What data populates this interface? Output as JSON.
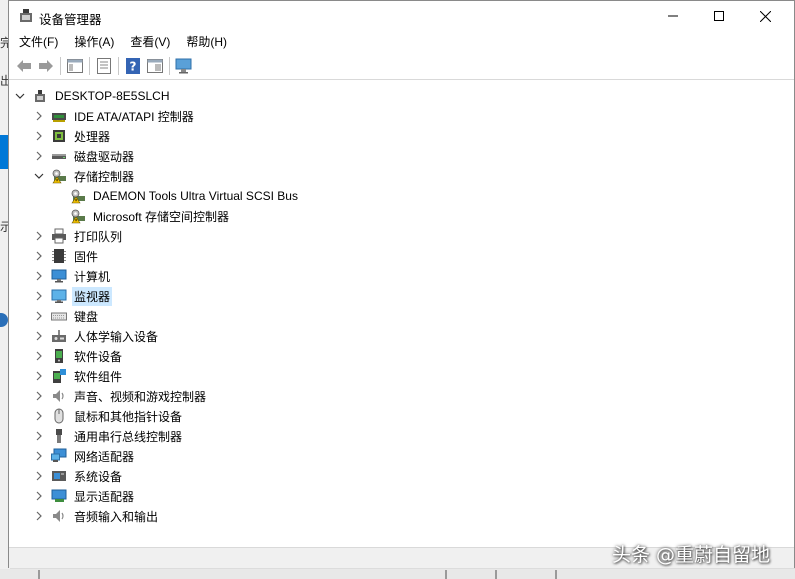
{
  "window": {
    "title": "设备管理器",
    "controls": {
      "minimize": "minimize-icon",
      "maximize": "maximize-icon",
      "close": "close-icon"
    }
  },
  "menubar": {
    "items": [
      "文件(F)",
      "操作(A)",
      "查看(V)",
      "帮助(H)"
    ]
  },
  "toolbar": {
    "buttons": [
      "back-arrow-icon",
      "forward-arrow-icon",
      "show-hide-console-tree-icon",
      "properties-icon",
      "help-icon",
      "action-view-icon",
      "scan-hardware-monitor-icon"
    ]
  },
  "background_window": {
    "fragments": [
      "完",
      "出",
      "示"
    ]
  },
  "tree": {
    "root": "DESKTOP-8E5SLCH",
    "nodes": [
      {
        "label": "IDE ATA/ATAPI 控制器",
        "icon": "ide-controller-icon",
        "expanded": false
      },
      {
        "label": "处理器",
        "icon": "processor-icon",
        "expanded": false
      },
      {
        "label": "磁盘驱动器",
        "icon": "disk-drive-icon",
        "expanded": false
      },
      {
        "label": "存储控制器",
        "icon": "storage-controller-icon",
        "expanded": true,
        "children": [
          {
            "label": "DAEMON Tools Ultra Virtual SCSI Bus",
            "icon": "storage-controller-icon"
          },
          {
            "label": "Microsoft 存储空间控制器",
            "icon": "storage-controller-icon"
          }
        ]
      },
      {
        "label": "打印队列",
        "icon": "printer-icon",
        "expanded": false
      },
      {
        "label": "固件",
        "icon": "firmware-icon",
        "expanded": false
      },
      {
        "label": "计算机",
        "icon": "computer-icon",
        "expanded": false
      },
      {
        "label": "监视器",
        "icon": "monitor-icon",
        "expanded": false,
        "selected": true
      },
      {
        "label": "键盘",
        "icon": "keyboard-icon",
        "expanded": false
      },
      {
        "label": "人体学输入设备",
        "icon": "hid-icon",
        "expanded": false
      },
      {
        "label": "软件设备",
        "icon": "software-device-icon",
        "expanded": false
      },
      {
        "label": "软件组件",
        "icon": "software-component-icon",
        "expanded": false
      },
      {
        "label": "声音、视频和游戏控制器",
        "icon": "speaker-icon",
        "expanded": false
      },
      {
        "label": "鼠标和其他指针设备",
        "icon": "mouse-icon",
        "expanded": false
      },
      {
        "label": "通用串行总线控制器",
        "icon": "usb-icon",
        "expanded": false
      },
      {
        "label": "网络适配器",
        "icon": "network-adapter-icon",
        "expanded": false
      },
      {
        "label": "系统设备",
        "icon": "system-device-icon",
        "expanded": false
      },
      {
        "label": "显示适配器",
        "icon": "display-adapter-icon",
        "expanded": false
      },
      {
        "label": "音频输入和输出",
        "icon": "speaker-icon",
        "expanded": false
      }
    ]
  },
  "watermark": "头条 @重蔚自留地",
  "colors": {
    "selection": "#cce8ff",
    "accent": "#0078d7"
  }
}
